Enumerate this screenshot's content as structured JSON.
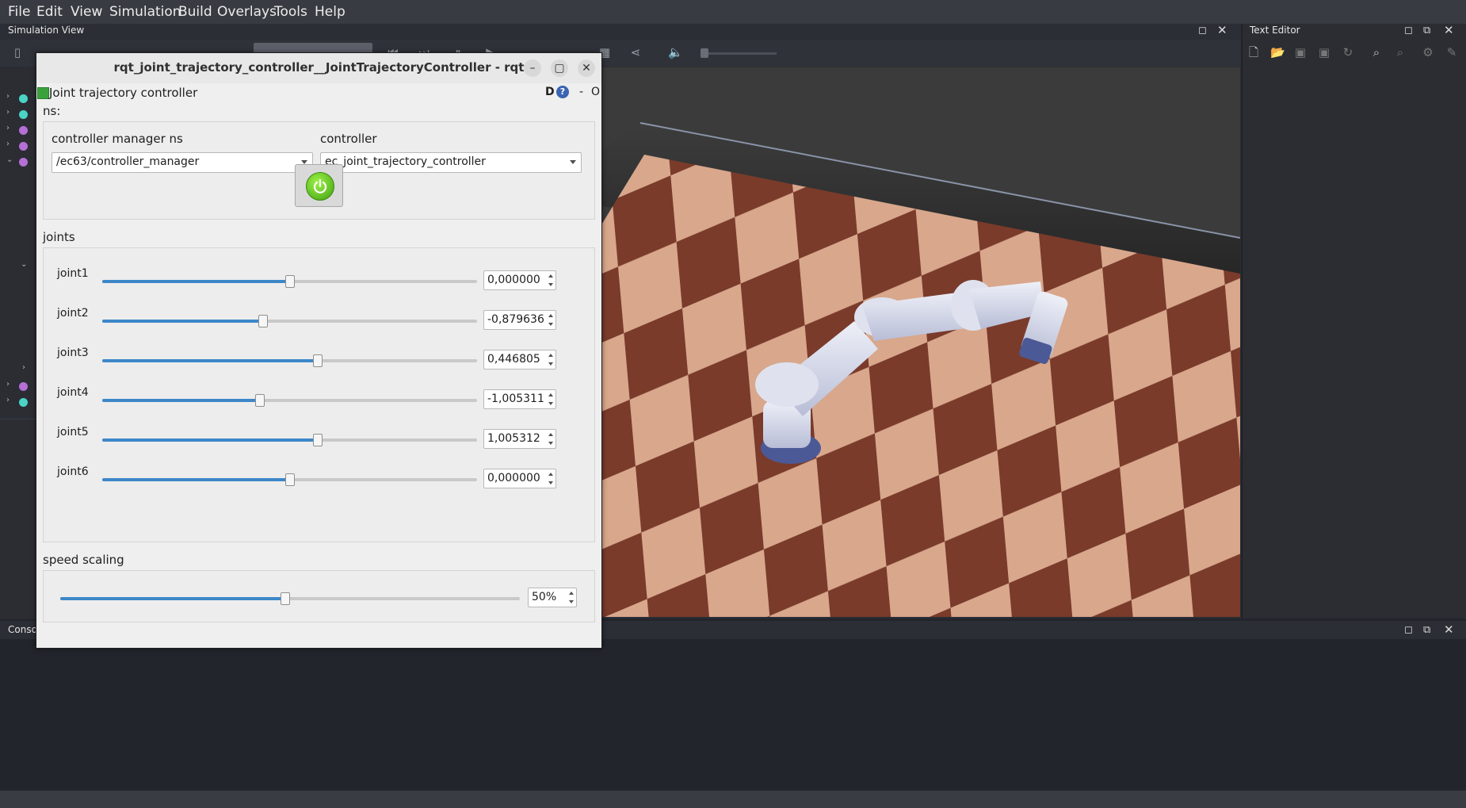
{
  "menu": {
    "items": [
      {
        "label": "File"
      },
      {
        "label": "Edit"
      },
      {
        "label": "View"
      },
      {
        "label": "Simulation"
      },
      {
        "label": "Build"
      },
      {
        "label": "Overlays"
      },
      {
        "label": "Tools"
      },
      {
        "label": "Help"
      }
    ]
  },
  "panels": {
    "simulation_view_title": "Simulation View",
    "text_editor_title": "Text Editor",
    "console_title": "Consol"
  },
  "rqt": {
    "window_title": "rqt_joint_trajectory_controller__JointTrajectoryController - rqt",
    "plugin_title": "Joint trajectory controller",
    "d_label": "D",
    "help_label": "?",
    "dash_label": "-",
    "o_label": "O",
    "ns_label": "ns:",
    "controller_manager_ns_label": "controller manager ns",
    "controller_manager_ns_value": "/ec63/controller_manager",
    "controller_label": "controller",
    "controller_value": "ec_joint_trajectory_controller",
    "joints_label": "joints",
    "joints": [
      {
        "name": "joint1",
        "value": "0,000000",
        "position": 0.5
      },
      {
        "name": "joint2",
        "value": "-0,879636",
        "position": 0.43
      },
      {
        "name": "joint3",
        "value": "0,446805",
        "position": 0.575
      },
      {
        "name": "joint4",
        "value": "-1,005311",
        "position": 0.42
      },
      {
        "name": "joint5",
        "value": "1,005312",
        "position": 0.575
      },
      {
        "name": "joint6",
        "value": "0,000000",
        "position": 0.5
      }
    ],
    "speed_scaling_label": "speed scaling",
    "speed_scaling_value": "50%",
    "speed_scaling_position": 0.49
  },
  "colors": {
    "accent": "#3d87c9",
    "power_on": "#5ccf1e"
  }
}
